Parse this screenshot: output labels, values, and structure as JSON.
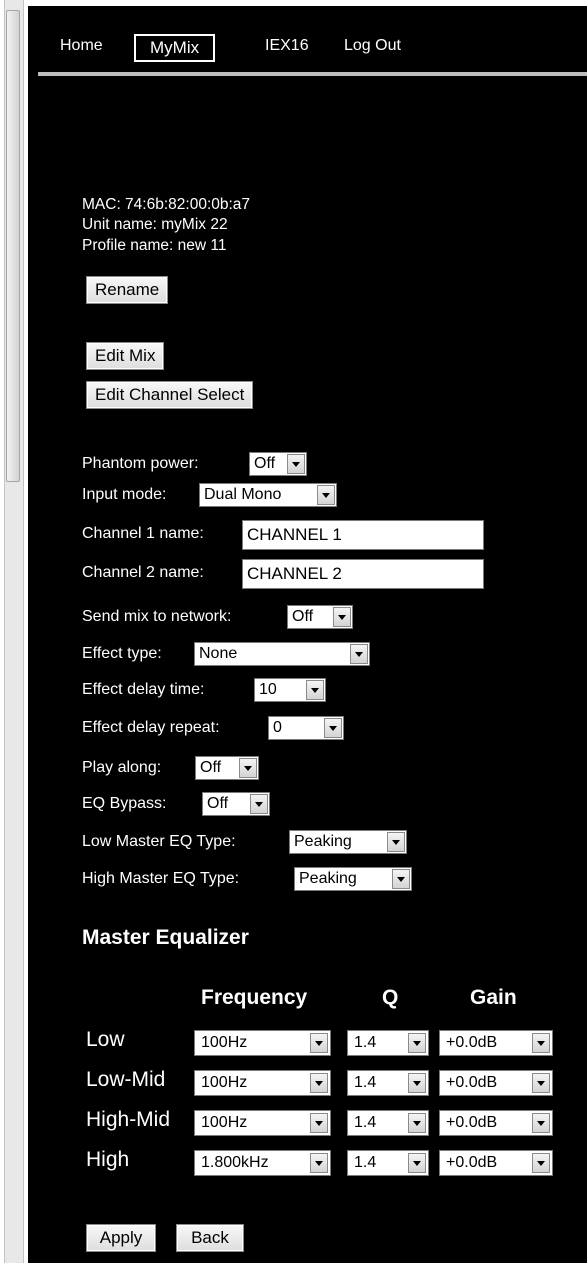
{
  "nav": {
    "items": [
      {
        "label": "Home"
      },
      {
        "label": "MyMix"
      },
      {
        "label": "IEX16"
      },
      {
        "label": "Log Out"
      }
    ],
    "active": "MyMix"
  },
  "unit": {
    "mac": "MAC: 74:6b:82:00:0b:a7",
    "unit_name": "Unit name: myMix 22",
    "profile_name": "Profile name: new 11"
  },
  "buttons": {
    "rename": "Rename",
    "edit_mix": "Edit Mix",
    "edit_channel_select": "Edit Channel Select",
    "apply": "Apply",
    "back": "Back"
  },
  "settings": {
    "phantom_power": {
      "label": "Phantom power:",
      "value": "Off"
    },
    "input_mode": {
      "label": "Input mode:",
      "value": "Dual Mono"
    },
    "channel1": {
      "label": "Channel 1 name:",
      "value": "CHANNEL 1"
    },
    "channel2": {
      "label": "Channel 2 name:",
      "value": "CHANNEL 2"
    },
    "send_mix": {
      "label": "Send mix to network:",
      "value": "Off"
    },
    "effect_type": {
      "label": "Effect type:",
      "value": "None"
    },
    "effect_delay_time": {
      "label": "Effect delay time:",
      "value": "10"
    },
    "effect_delay_repeat": {
      "label": "Effect delay repeat:",
      "value": "0"
    },
    "play_along": {
      "label": "Play along:",
      "value": "Off"
    },
    "eq_bypass": {
      "label": "EQ Bypass:",
      "value": "Off"
    },
    "low_master_eq": {
      "label": "Low Master EQ Type:",
      "value": "Peaking"
    },
    "high_master_eq": {
      "label": "High Master EQ Type:",
      "value": "Peaking"
    }
  },
  "equalizer": {
    "title": "Master Equalizer",
    "headers": {
      "frequency": "Frequency",
      "q": "Q",
      "gain": "Gain"
    },
    "bands": [
      {
        "name": "Low",
        "frequency": "100Hz",
        "q": "1.4",
        "gain": "+0.0dB"
      },
      {
        "name": "Low-Mid",
        "frequency": "100Hz",
        "q": "1.4",
        "gain": "+0.0dB"
      },
      {
        "name": "High-Mid",
        "frequency": "100Hz",
        "q": "1.4",
        "gain": "+0.0dB"
      },
      {
        "name": "High",
        "frequency": "1.800kHz",
        "q": "1.4",
        "gain": "+0.0dB"
      }
    ]
  },
  "colors": {
    "background": "#000000",
    "text": "#ffffff",
    "control_bg": "#ffffff"
  }
}
